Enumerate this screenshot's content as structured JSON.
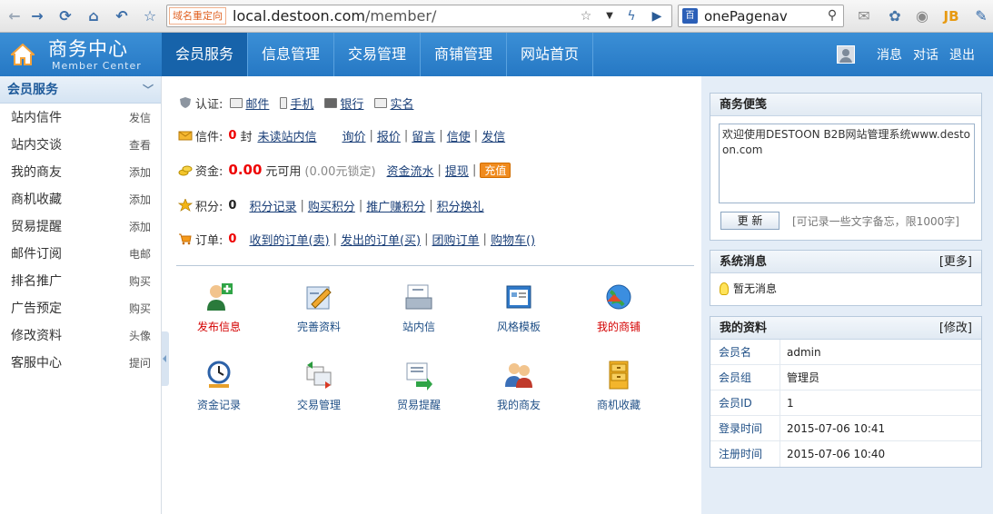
{
  "browser": {
    "url_tag": "域名重定向",
    "url_host": "local.destoon.com",
    "url_path": "/member/",
    "search_value": "onePagenav",
    "icons": [
      "back-icon",
      "forward-icon",
      "reload-icon",
      "home-icon",
      "undo-icon",
      "star-icon"
    ]
  },
  "header": {
    "title": "商务中心",
    "subtitle": "Member Center",
    "nav": [
      "会员服务",
      "信息管理",
      "交易管理",
      "商铺管理",
      "网站首页"
    ],
    "user_links": [
      "消息",
      "对话",
      "退出"
    ]
  },
  "sidebar": {
    "title": "会员服务",
    "items": [
      {
        "label": "站内信件",
        "action": "发信"
      },
      {
        "label": "站内交谈",
        "action": "查看"
      },
      {
        "label": "我的商友",
        "action": "添加"
      },
      {
        "label": "商机收藏",
        "action": "添加"
      },
      {
        "label": "贸易提醒",
        "action": "添加"
      },
      {
        "label": "邮件订阅",
        "action": "电邮"
      },
      {
        "label": "排名推广",
        "action": "购买"
      },
      {
        "label": "广告预定",
        "action": "购买"
      },
      {
        "label": "修改资料",
        "action": "头像"
      },
      {
        "label": "客服中心",
        "action": "提问"
      }
    ]
  },
  "status": {
    "auth": {
      "label": "认证:",
      "items": [
        "邮件",
        "手机",
        "银行",
        "实名"
      ]
    },
    "mail": {
      "label": "信件:",
      "count": "0",
      "unit": "封",
      "unread_link": "未读站内信",
      "links": [
        "询价",
        "报价",
        "留言",
        "信使",
        "发信"
      ]
    },
    "funds": {
      "label": "资金:",
      "amount": "0.00",
      "unit": "元可用",
      "locked": "(0.00元锁定)",
      "links": [
        "资金流水",
        "提现"
      ],
      "recharge": "充值"
    },
    "points": {
      "label": "积分:",
      "value": "0",
      "links": [
        "积分记录",
        "购买积分",
        "推广赚积分",
        "积分换礼"
      ]
    },
    "orders": {
      "label": "订单:",
      "count": "0",
      "links": [
        "收到的订单(卖)",
        "发出的订单(买)",
        "团购订单",
        "购物车()"
      ]
    }
  },
  "shortcuts": [
    {
      "label": "发布信息",
      "icon": "publish-user-icon",
      "hot": true
    },
    {
      "label": "完善资料",
      "icon": "edit-profile-icon",
      "hot": false
    },
    {
      "label": "站内信",
      "icon": "inbox-icon",
      "hot": false
    },
    {
      "label": "风格模板",
      "icon": "template-icon",
      "hot": false
    },
    {
      "label": "我的商铺",
      "icon": "shop-globe-icon",
      "hot": true
    },
    {
      "label": "资金记录",
      "icon": "clock-icon",
      "hot": false
    },
    {
      "label": "交易管理",
      "icon": "trade-icon",
      "hot": false
    },
    {
      "label": "贸易提醒",
      "icon": "reminder-icon",
      "hot": false
    },
    {
      "label": "我的商友",
      "icon": "friends-icon",
      "hot": false
    },
    {
      "label": "商机收藏",
      "icon": "cabinet-icon",
      "hot": false
    }
  ],
  "notepad": {
    "title": "商务便笺",
    "content": "欢迎使用DESTOON B2B网站管理系统www.destoon.com",
    "button": "更 新",
    "hint": "[可记录一些文字备忘，限1000字]"
  },
  "messages": {
    "title": "系统消息",
    "more": "[更多]",
    "empty": "暂无消息"
  },
  "profile": {
    "title": "我的资料",
    "edit": "[修改]",
    "rows": [
      {
        "key": "会员名",
        "value": "admin"
      },
      {
        "key": "会员组",
        "value": "管理员"
      },
      {
        "key": "会员ID",
        "value": "1"
      },
      {
        "key": "登录时间",
        "value": "2015-07-06 10:41"
      },
      {
        "key": "注册时间",
        "value": "2015-07-06 10:40"
      }
    ]
  },
  "colors": {
    "header_blue": "#2678c4",
    "nav_active": "#1763aa",
    "hot_red": "#d40000",
    "recharge_orange": "#f08b1e"
  }
}
